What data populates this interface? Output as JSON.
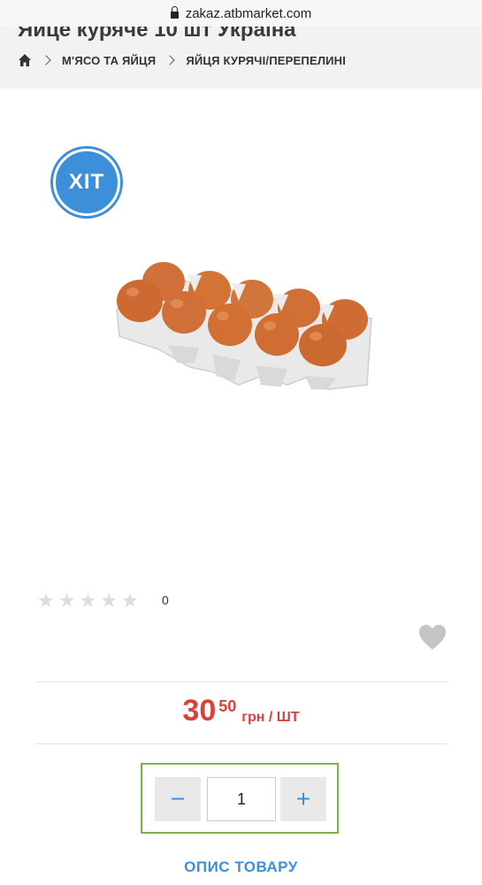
{
  "browser": {
    "url": "zakaz.atbmarket.com"
  },
  "product": {
    "title": "Яйце куряче 10 шт Україна",
    "badge": "ХІТ",
    "rating_count": "0",
    "rating_value": 0,
    "rating_max": 5
  },
  "breadcrumb": {
    "items": [
      {
        "label": "М'ЯСО ТА ЯЙЦЯ"
      },
      {
        "label": "ЯЙЦЯ КУРЯЧІ/ПЕРЕПЕЛИНІ"
      }
    ]
  },
  "price": {
    "whole": "30",
    "fraction": "50",
    "unit": "грн / ШТ"
  },
  "quantity": {
    "minus": "−",
    "value": "1",
    "plus": "+"
  },
  "tabs": {
    "description": "ОПИС ТОВАРУ"
  },
  "colors": {
    "accent_blue": "#3d8fd9",
    "price_red": "#d9423b",
    "qty_border_green": "#7cb342"
  },
  "icons": [
    "lock-icon",
    "home-icon",
    "chevron-right-icon",
    "star-icon",
    "heart-icon"
  ]
}
